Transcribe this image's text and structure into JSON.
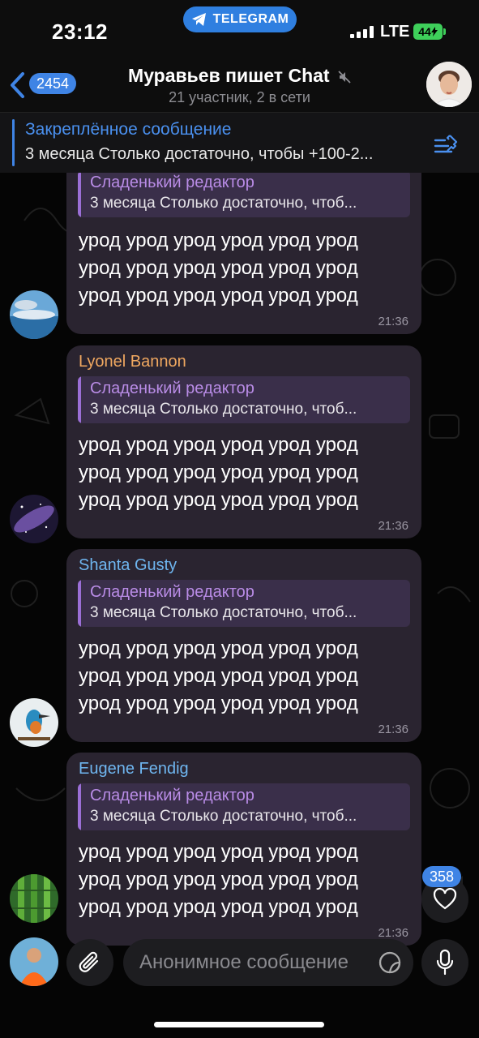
{
  "status": {
    "time": "23:12",
    "app_pill": "TELEGRAM",
    "network": "LTE",
    "battery": "44"
  },
  "header": {
    "back_count": "2454",
    "title": "Муравьев пишет Chat",
    "subtitle": "21 участник, 2 в сети"
  },
  "pinned": {
    "title": "Закреплённое сообщение",
    "text": "3 месяца Столько достаточно, чтобы +100-2..."
  },
  "messages": [
    {
      "sender": "",
      "sender_color": "",
      "quote_title": "Сладенький редактор",
      "quote_text": "3 месяца Столько достаточно, чтоб...",
      "lines": [
        "урод урод урод урод урод урод",
        "урод урод урод урод урод урод",
        "урод урод урод урод урод урод"
      ],
      "time": "21:36"
    },
    {
      "sender": "Lyonel Bannon",
      "sender_color": "#f0a860",
      "quote_title": "Сладенький редактор",
      "quote_text": "3 месяца Столько достаточно, чтоб...",
      "lines": [
        "урод урод урод урод урод урод",
        "урод урод урод урод урод урод",
        "урод урод урод урод урод урод"
      ],
      "time": "21:36"
    },
    {
      "sender": "Shanta Gusty",
      "sender_color": "#6fb6f0",
      "quote_title": "Сладенький редактор",
      "quote_text": "3 месяца Столько достаточно, чтоб...",
      "lines": [
        "урод урод урод урод урод урод",
        "урод урод урод урод урод урод",
        "урод урод урод урод урод урод"
      ],
      "time": "21:36"
    },
    {
      "sender": "Eugene Fendig",
      "sender_color": "#6fb6f0",
      "quote_title": "Сладенький редактор",
      "quote_text": "3 месяца Столько достаточно, чтоб...",
      "lines": [
        "урод урод урод урод урод урод",
        "урод урод урод урод урод урод",
        "урод урод урод урод урод урод"
      ],
      "time": "21:36"
    }
  ],
  "composer": {
    "placeholder": "Анонимное сообщение"
  },
  "reaction": {
    "count": "358",
    "icon": "heart-icon"
  },
  "colors": {
    "accent": "#3f84e5",
    "bubble": "#2a2430",
    "quote": "#3a2f4a"
  }
}
